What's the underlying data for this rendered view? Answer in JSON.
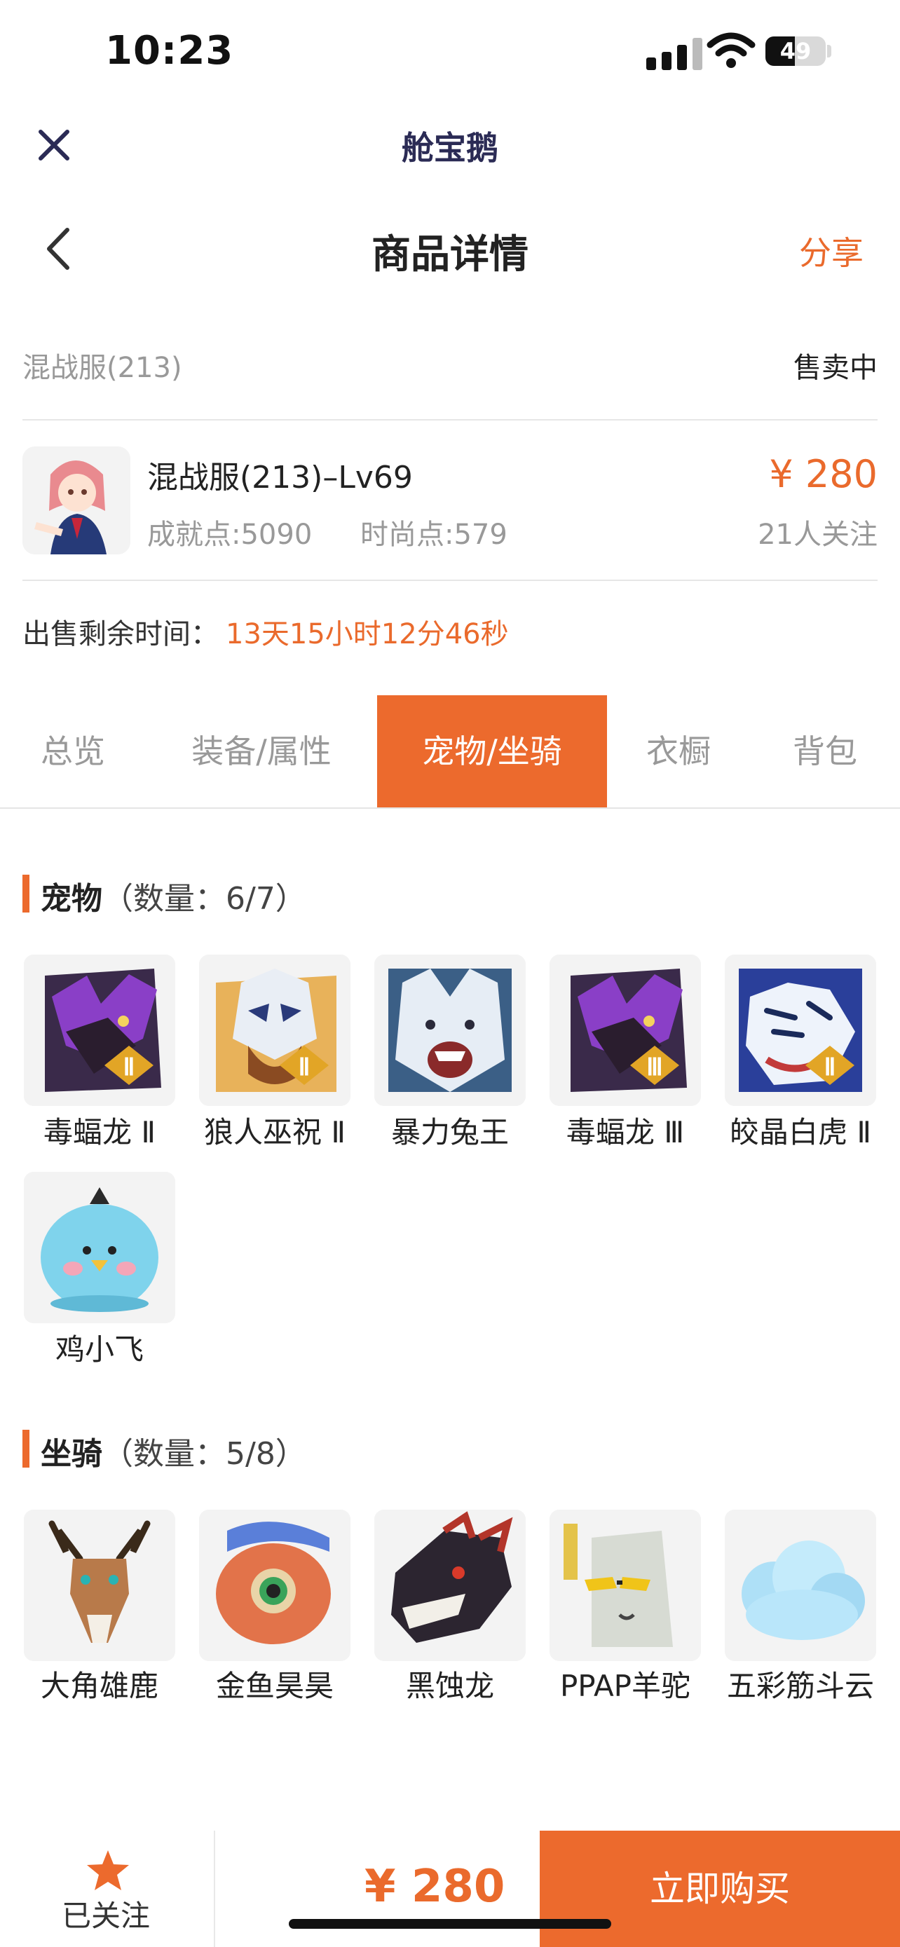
{
  "status_bar": {
    "time": "10:23",
    "battery": "49",
    "battery_level": 0.49
  },
  "header": {
    "app_name": "舱宝鹅",
    "title": "商品详情",
    "share_label": "分享"
  },
  "server": {
    "name": "混战服(213)",
    "status": "售卖中"
  },
  "product": {
    "title": "混战服(213)–Lv69",
    "achievement": "成就点:5090",
    "fashion": "时尚点:579",
    "price": "¥ 280",
    "followers": "21人关注"
  },
  "remaining": {
    "label": "出售剩余时间：",
    "value": "13天15小时12分46秒"
  },
  "tabs": [
    {
      "label": "总览"
    },
    {
      "label": "装备/属性"
    },
    {
      "label": "宠物/坐骑"
    },
    {
      "label": "衣橱"
    },
    {
      "label": "背包"
    }
  ],
  "pets": {
    "title": "宠物",
    "count": "（数量：6/7）",
    "items": [
      {
        "name": "毒蝠龙 Ⅱ",
        "icon": "poison-bat-dragon-icon"
      },
      {
        "name": "狼人巫祝 Ⅱ",
        "icon": "werewolf-shaman-icon"
      },
      {
        "name": "暴力兔王",
        "icon": "violent-rabbit-king-icon"
      },
      {
        "name": "毒蝠龙 Ⅲ",
        "icon": "poison-bat-dragon-icon"
      },
      {
        "name": "皎晶白虎 Ⅱ",
        "icon": "crystal-white-tiger-icon"
      },
      {
        "name": "鸡小飞",
        "icon": "chick-icon"
      }
    ]
  },
  "mounts": {
    "title": "坐骑",
    "count": "（数量：5/8）",
    "items": [
      {
        "name": "大角雄鹿",
        "icon": "stag-icon"
      },
      {
        "name": "金鱼昊昊",
        "icon": "goldfish-icon"
      },
      {
        "name": "黑蚀龙",
        "icon": "black-dragon-icon"
      },
      {
        "name": "PPAP羊驼",
        "icon": "alpaca-icon"
      },
      {
        "name": "五彩筋斗云",
        "icon": "cloud-icon"
      }
    ]
  },
  "bottom_bar": {
    "follow_label": "已关注",
    "price": "¥ 280",
    "buy_label": "立即购买"
  },
  "colors": {
    "accent": "#ec6a2d",
    "muted": "#999999",
    "card_bg": "#f3f3f3"
  }
}
